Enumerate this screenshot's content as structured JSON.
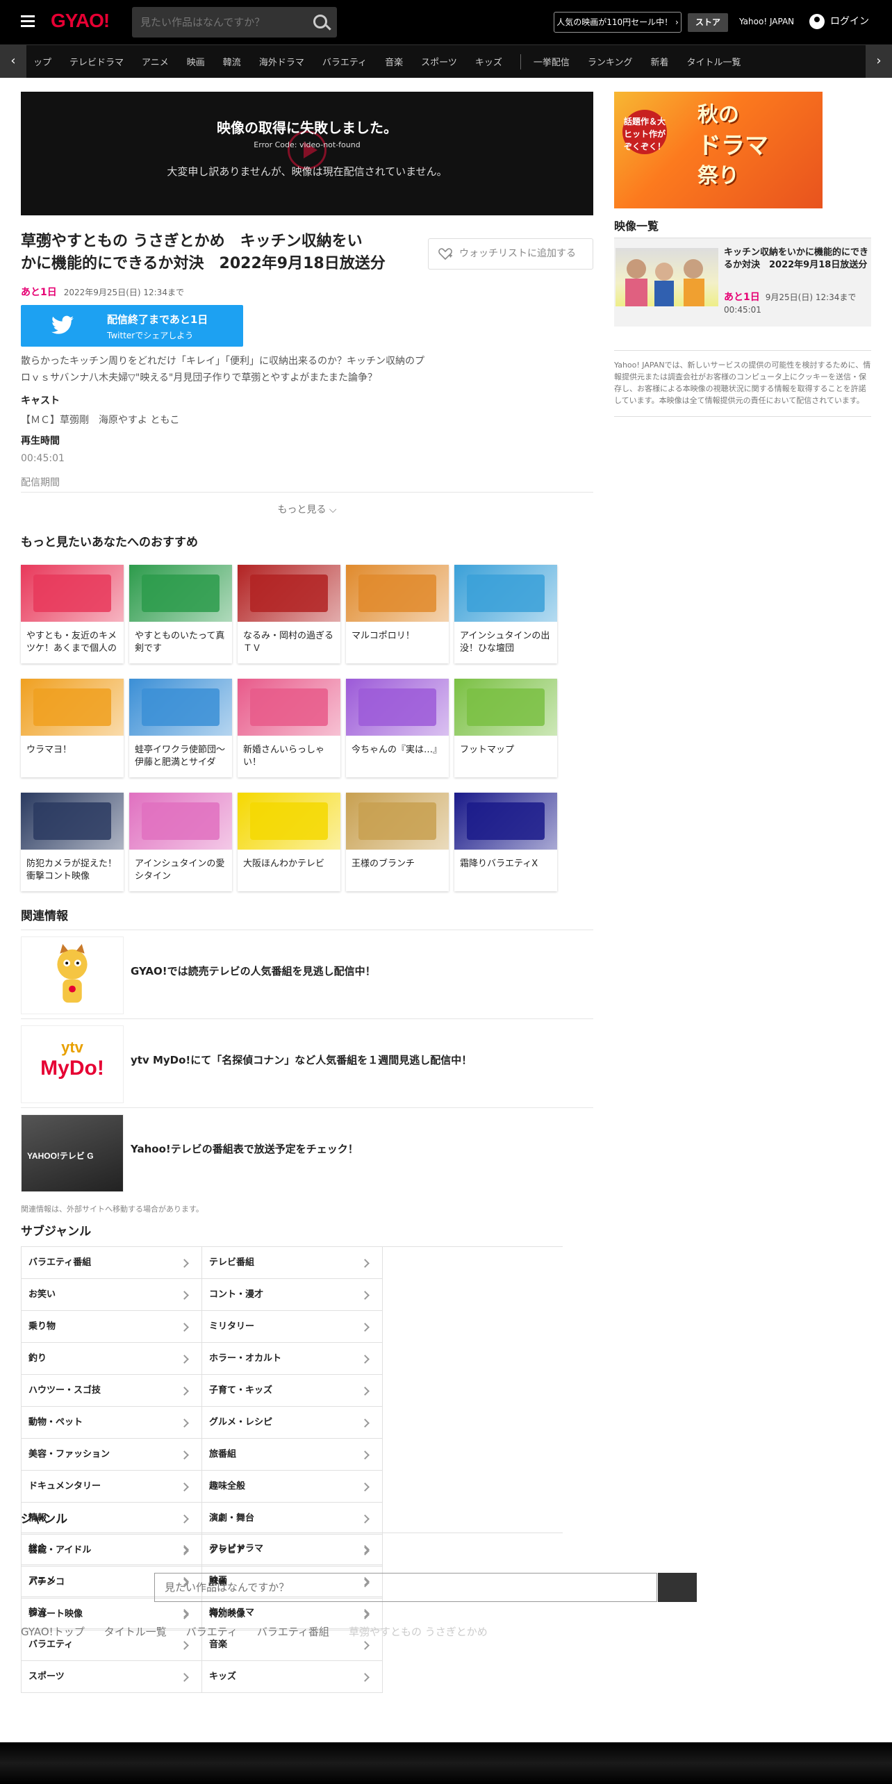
{
  "header": {
    "logo": "GYAO!",
    "search_placeholder": "見たい作品はなんですか？",
    "promo": "人気の映画が110円セール中！",
    "store": "ストア",
    "yahoo": "Yahoo! JAPAN",
    "login": "ログイン"
  },
  "nav": {
    "items": [
      "ップ",
      "テレビドラマ",
      "アニメ",
      "映画",
      "韓流",
      "海外ドラマ",
      "バラエティ",
      "音楽",
      "スポーツ",
      "キッズ"
    ],
    "items2": [
      "一挙配信",
      "ランキング",
      "新着",
      "タイトル一覧"
    ],
    "prev": "‹",
    "next": "›"
  },
  "player": {
    "error_title": "映像の取得に失敗しました。",
    "error_code": "Error Code: video-not-found",
    "error_msg": "大変申し訳ありませんが、映像は現在配信されていません。"
  },
  "program": {
    "title": "草彅やすとものうさぎとかめ　キッチン収納をいかに機能的にできるか対決　2022年9月18日放送分",
    "title_l1": "草彅やすともの うさぎとかめ　キッチン収納をい",
    "title_l2": "かに機能的にできるか対決　2022年9月18日放送分",
    "watchlist": "ウォッチリストに追加する",
    "remaining": "あと1日",
    "expire": "2022年9月25日(日) 12:34まで",
    "share_main": "配信終了まであと1日",
    "share_sub": "Twitterでシェアしよう",
    "desc_l1": "散らかったキッチン周りをどれだけ「キレイ」「便利」に収納出来るのか？キッチン収納のプ",
    "desc_l2": "ロｖｓサバンナ八木夫婦▽\"映える\"月見団子作りで草彅とやすよがまたまた論争？",
    "cast_label": "キャスト",
    "cast": "【ＭＣ】草彅剛　海原やすよ ともこ",
    "runtime_label": "再生時間",
    "runtime": "00:45:01",
    "period_label": "配信期間",
    "more": "もっと見る"
  },
  "recommend": {
    "heading": "もっと見たいあなたへのおすすめ",
    "items": [
      {
        "name": "やすとも・友近のキメツケ！あくまで個人の",
        "color": "#e8385a"
      },
      {
        "name": "やすとものいたって真剣です",
        "color": "#2c9b4b"
      },
      {
        "name": "なるみ・岡村の過ぎるＴＶ",
        "color": "#b22222"
      },
      {
        "name": "マルコポロリ！",
        "color": "#e08a2c"
      },
      {
        "name": "アインシュタインの出没！ひな壇団",
        "color": "#3aa0d8"
      },
      {
        "name": "ウラマヨ！",
        "color": "#f0a020"
      },
      {
        "name": "蛙亭イワクラ使節団～伊藤と肥満とサイダ",
        "color": "#3b8fd6"
      },
      {
        "name": "新婚さんいらっしゃい！",
        "color": "#e85a8a"
      },
      {
        "name": "今ちゃんの『実は…』",
        "color": "#9c5ad8"
      },
      {
        "name": "フットマップ",
        "color": "#7ac043"
      },
      {
        "name": "防犯カメラが捉えた！衝撃コント映像",
        "color": "#2a3a60"
      },
      {
        "name": "アインシュタインの愛シタイン",
        "color": "#e070c0"
      },
      {
        "name": "大阪ほんわかテレビ",
        "color": "#f5d800"
      },
      {
        "name": "王様のブランチ",
        "color": "#c8a050"
      },
      {
        "name": "霜降りバラエティX",
        "color": "#1a1a8a"
      }
    ]
  },
  "related": {
    "heading": "関連情報",
    "items": [
      {
        "title": "GYAO!では読売テレビの人気番組を見逃し配信中！"
      },
      {
        "title": "ytv MyDo!にて「名探偵コナン」など人気番組を１週間見逃し配信中！"
      },
      {
        "title": "Yahoo!テレビの番組表で放送予定をチェック！"
      }
    ],
    "note": "関連情報は、外部サイトへ移動する場合があります。",
    "ytv_logo": "ytv",
    "mydo_logo": "MyDo!",
    "yahoo_tv_logo": "YAHOO!テレビ G"
  },
  "subgenre": {
    "heading": "サブジャンル",
    "items": [
      "バラエティ番組",
      "テレビ番組",
      "お笑い",
      "コント・漫才",
      "乗り物",
      "ミリタリー",
      "釣り",
      "ホラー・オカルト",
      "ハウツー・スゴ技",
      "子育て・キッズ",
      "動物・ペット",
      "グルメ・レシピ",
      "美容・ファッション",
      "旅番組",
      "ドキュメンタリー",
      "趣味全般",
      "情報",
      "演劇・舞台",
      "芸能・アイドル",
      "グラビア",
      "パチンコ",
      "麻雀",
      "ショート映像",
      "特別映像"
    ]
  },
  "genre": {
    "heading": "ジャンル",
    "items": [
      "総合",
      "テレビドラマ",
      "アニメ",
      "映画",
      "韓流",
      "海外ドラマ",
      "バラエティ",
      "音楽",
      "スポーツ",
      "キッズ"
    ]
  },
  "footer": {
    "search_placeholder": "見たい作品はなんですか？",
    "breadcrumbs": [
      "GYAO!トップ",
      "タイトル一覧",
      "バラエティ",
      "バラエティ番組",
      "草彅やすともの うさぎとかめ"
    ]
  },
  "sidebar": {
    "banner_tag": "話題作＆大ヒット作がぞくぞく！",
    "banner_title": "秋のドラマ祭り",
    "banner_title_l1": "秋の",
    "banner_title_l2": "ドラマ",
    "banner_title_l3": "祭り",
    "video_list": "映像一覧",
    "video": {
      "title": "キッチン収納をいかに機能的にできるか対決　2022年9月18日放送分",
      "remaining": "あと1日",
      "expire": "9月25日(日) 12:34まで",
      "runtime": "00:45:01"
    },
    "disclaimer": "Yahoo! JAPANでは、新しいサービスの提供の可能性を検討するために、情報提供元または調査会社がお客様のコンピュータ上にクッキーを送信・保存し、お客様による本映像の視聴状況に関する情報を取得することを許諾しています。本映像は全て情報提供元の責任において配信されています。"
  },
  "colors": {
    "brand": "#e60033",
    "accent_pink": "#e60073",
    "twitter": "#1da1f2"
  }
}
